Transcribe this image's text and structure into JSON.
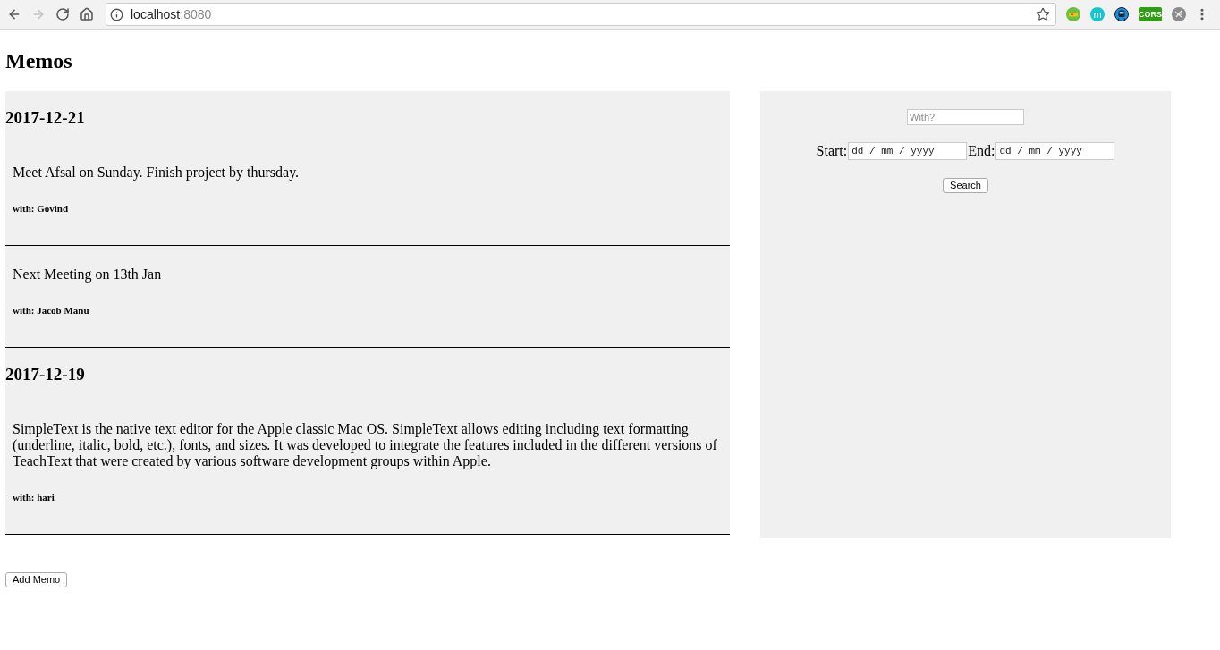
{
  "browser": {
    "nav_buttons": [
      {
        "kind": "back",
        "disabled": false
      },
      {
        "kind": "forward",
        "disabled": true
      },
      {
        "kind": "reload",
        "disabled": false
      },
      {
        "kind": "home",
        "disabled": false
      }
    ],
    "url": {
      "host": "localhost",
      "port": ":8080"
    },
    "extensions": [
      {
        "kind": "ticket"
      },
      {
        "kind": "letter",
        "label": "m"
      },
      {
        "kind": "train"
      },
      {
        "kind": "tag",
        "label": "CORS"
      },
      {
        "kind": "scribble"
      }
    ]
  },
  "page": {
    "title": "Memos"
  },
  "memo_groups": [
    {
      "date": "2017-12-21",
      "memos": [
        {
          "text": "Meet Afsal on Sunday. Finish project by thursday.",
          "with": "with: Govind"
        },
        {
          "text": "Next Meeting on 13th Jan",
          "with": "with: Jacob Manu"
        }
      ]
    },
    {
      "date": "2017-12-19",
      "memos": [
        {
          "text": "SimpleText is the native text editor for the Apple classic Mac OS. SimpleText allows editing including text formatting (underline, italic, bold, etc.), fonts, and sizes. It was developed to integrate the features included in the different versions of TeachText that were created by various software development groups within Apple.",
          "with": "with: hari"
        }
      ]
    }
  ],
  "filter": {
    "with_field": {
      "placeholder": "With?"
    },
    "start": {
      "label": "Start:",
      "placeholder": "dd / mm / yyyy"
    },
    "end": {
      "label": "End:",
      "placeholder": "dd / mm / yyyy"
    },
    "search_button": "Search"
  },
  "add_memo_button": "Add Memo"
}
